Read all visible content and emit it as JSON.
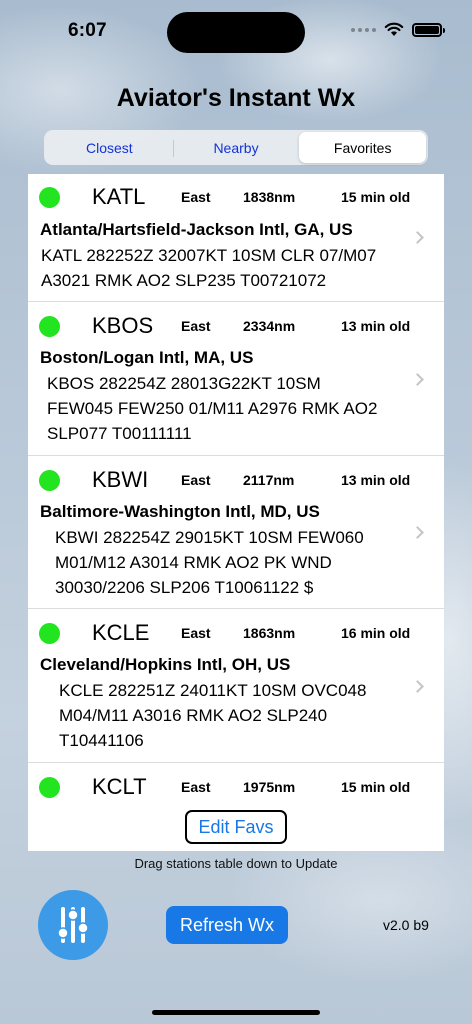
{
  "status_bar": {
    "time": "6:07",
    "battery_level": 1.0
  },
  "app": {
    "title": "Aviator's Instant Wx",
    "version": "v2.0 b9"
  },
  "tabs": [
    {
      "label": "Closest",
      "selected": false
    },
    {
      "label": "Nearby",
      "selected": false
    },
    {
      "label": "Favorites",
      "selected": true
    }
  ],
  "stations": [
    {
      "ident": "KATL",
      "direction": "East",
      "distance": "1838nm",
      "age": "15 min old",
      "name": "Atlanta/Hartsfield-Jackson Intl, GA, US",
      "metar_lines": [
        "KATL 282252Z 32007KT 10SM CLR 07/M07",
        "A3021 RMK AO2 SLP235 T00721072"
      ],
      "status_color": "#22e41f"
    },
    {
      "ident": "KBOS",
      "direction": "East",
      "distance": "2334nm",
      "age": "13 min old",
      "name": "Boston/Logan Intl, MA, US",
      "metar_lines": [
        "KBOS 282254Z 28013G22KT 10SM",
        "FEW045 FEW250 01/M11 A2976 RMK AO2",
        "SLP077 T00111111"
      ],
      "status_color": "#22e41f"
    },
    {
      "ident": "KBWI",
      "direction": "East",
      "distance": "2117nm",
      "age": "13 min old",
      "name": "Baltimore-Washington Intl, MD, US",
      "metar_lines": [
        "KBWI 282254Z 29015KT 10SM FEW060",
        "M01/M12 A3014 RMK AO2 PK WND",
        "30030/2206 SLP206 T10061122 $"
      ],
      "status_color": "#22e41f"
    },
    {
      "ident": "KCLE",
      "direction": "East",
      "distance": "1863nm",
      "age": "16 min old",
      "name": "Cleveland/Hopkins Intl, OH, US",
      "metar_lines": [
        "KCLE 282251Z 24011KT 10SM OVC048",
        "M04/M11 A3016 RMK AO2 SLP240",
        "T10441106"
      ],
      "status_color": "#22e41f"
    },
    {
      "ident": "KCLT",
      "direction": "East",
      "distance": "1975nm",
      "age": "15 min old",
      "status_color": "#22e41f"
    }
  ],
  "edit_favs_label": "Edit Favs",
  "hint": "Drag stations table down to Update",
  "refresh_label": "Refresh Wx",
  "icons": {
    "settings": "sliders-icon",
    "row_disclosure": "chevron-right-icon",
    "wifi": "wifi-icon",
    "battery": "battery-icon"
  },
  "colors": {
    "accent": "#1878e6",
    "settings_button": "#3d9ae6",
    "status_good": "#22e41f"
  }
}
